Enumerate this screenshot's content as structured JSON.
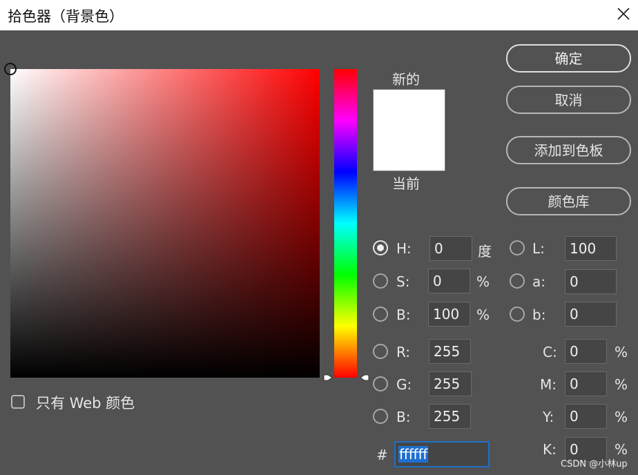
{
  "window": {
    "title": "拾色器（背景色）"
  },
  "icons": {
    "close": "close-icon",
    "field_marker": "circle-marker-icon",
    "hue_slider": "slider-arrow-icon",
    "web_checkbox": "checkbox-icon"
  },
  "colors": {
    "selected": "#ffffff",
    "hue": "#ff0000",
    "hex_highlight": "#1f6fd0"
  },
  "preview": {
    "new_label": "新的",
    "current_label": "当前"
  },
  "buttons": {
    "ok": "确定",
    "cancel": "取消",
    "add_swatch": "添加到色板",
    "libraries": "颜色库"
  },
  "web_only": {
    "label": "只有 Web 颜色",
    "checked": false
  },
  "hsb": {
    "h": {
      "label": "H:",
      "value": "0",
      "unit": "度",
      "selected": true
    },
    "s": {
      "label": "S:",
      "value": "0",
      "unit": "%"
    },
    "b": {
      "label": "B:",
      "value": "100",
      "unit": "%"
    }
  },
  "rgb": {
    "r": {
      "label": "R:",
      "value": "255"
    },
    "g": {
      "label": "G:",
      "value": "255"
    },
    "b": {
      "label": "B:",
      "value": "255"
    }
  },
  "lab": {
    "l": {
      "label": "L:",
      "value": "100"
    },
    "a": {
      "label": "a:",
      "value": "0"
    },
    "b": {
      "label": "b:",
      "value": "0"
    }
  },
  "cmyk": {
    "c": {
      "label": "C:",
      "value": "0",
      "unit": "%"
    },
    "m": {
      "label": "M:",
      "value": "0",
      "unit": "%"
    },
    "y": {
      "label": "Y:",
      "value": "0",
      "unit": "%"
    },
    "k": {
      "label": "K:",
      "value": "0",
      "unit": "%"
    }
  },
  "hex": {
    "label": "#",
    "value": "ffffff"
  },
  "watermark": "CSDN @小林up"
}
